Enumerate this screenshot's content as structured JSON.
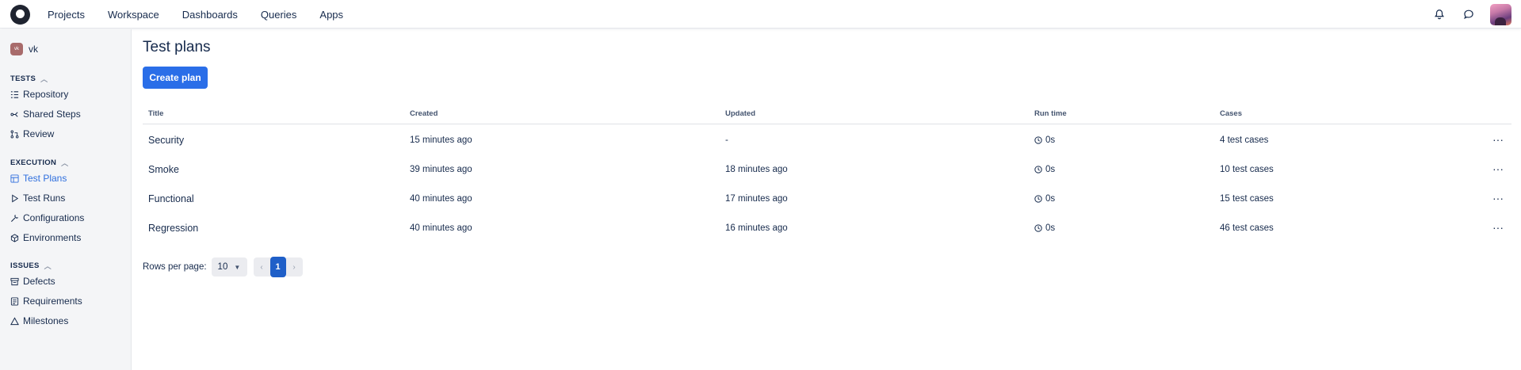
{
  "topnav": {
    "items": [
      "Projects",
      "Workspace",
      "Dashboards",
      "Queries",
      "Apps"
    ],
    "icons": [
      "bell-icon",
      "chat-icon"
    ],
    "logo_icon": "app-logo"
  },
  "sidebar": {
    "project_badge": "vk",
    "project_name": "vk",
    "sections": [
      {
        "title": "TESTS",
        "items": [
          {
            "label": "Repository",
            "icon": "repository-icon"
          },
          {
            "label": "Shared Steps",
            "icon": "shared-steps-icon"
          },
          {
            "label": "Review",
            "icon": "review-icon"
          }
        ]
      },
      {
        "title": "EXECUTION",
        "items": [
          {
            "label": "Test Plans",
            "icon": "test-plans-icon",
            "active": true
          },
          {
            "label": "Test Runs",
            "icon": "play-icon"
          },
          {
            "label": "Configurations",
            "icon": "wrench-icon"
          },
          {
            "label": "Environments",
            "icon": "cube-icon"
          }
        ]
      },
      {
        "title": "ISSUES",
        "items": [
          {
            "label": "Defects",
            "icon": "defects-icon"
          },
          {
            "label": "Requirements",
            "icon": "requirements-icon"
          },
          {
            "label": "Milestones",
            "icon": "milestone-icon"
          }
        ]
      }
    ]
  },
  "main": {
    "title": "Test plans",
    "create_button": "Create plan",
    "columns": [
      "Title",
      "Created",
      "Updated",
      "Run time",
      "Cases"
    ],
    "rows": [
      {
        "title": "Security",
        "created": "15 minutes ago",
        "updated": "-",
        "run_time": "0s",
        "cases": "4 test cases"
      },
      {
        "title": "Smoke",
        "created": "39 minutes ago",
        "updated": "18 minutes ago",
        "run_time": "0s",
        "cases": "10 test cases"
      },
      {
        "title": "Functional",
        "created": "40 minutes ago",
        "updated": "17 minutes ago",
        "run_time": "0s",
        "cases": "15 test cases"
      },
      {
        "title": "Regression",
        "created": "40 minutes ago",
        "updated": "16 minutes ago",
        "run_time": "0s",
        "cases": "46 test cases"
      }
    ],
    "row_menu": "···",
    "pagination": {
      "rows_per_page_label": "Rows per page:",
      "rows_per_page": "10",
      "prev": "‹",
      "current_page": "1",
      "next": "›"
    }
  },
  "colors": {
    "accent": "#2a6ee8",
    "active_nav": "#2f6fde",
    "sidebar_bg": "#f4f5f7"
  }
}
